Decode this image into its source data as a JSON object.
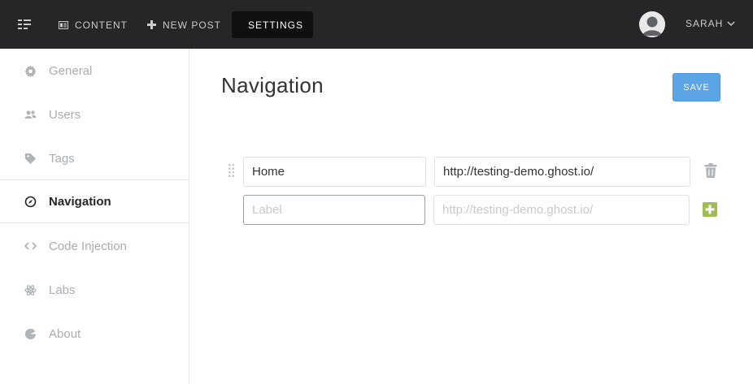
{
  "topbar": {
    "menu_icon": "sidebar-toggle-icon",
    "items": [
      {
        "label": "Content",
        "icon": "content-icon"
      },
      {
        "label": "New Post",
        "icon": "plus-icon"
      },
      {
        "label": "Settings",
        "icon": "gears-icon"
      }
    ],
    "user": {
      "name": "SARAH",
      "avatar_icon": "user-avatar"
    }
  },
  "sidebar": {
    "items": [
      {
        "label": "General",
        "icon": "gear-icon"
      },
      {
        "label": "Users",
        "icon": "users-icon"
      },
      {
        "label": "Tags",
        "icon": "tag-icon"
      },
      {
        "label": "Navigation",
        "icon": "compass-icon",
        "active": true
      },
      {
        "label": "Code Injection",
        "icon": "code-icon"
      },
      {
        "label": "Labs",
        "icon": "atom-icon"
      },
      {
        "label": "About",
        "icon": "ghost-icon"
      }
    ]
  },
  "main": {
    "title": "Navigation",
    "save_label": "SAVE",
    "nav_items": [
      {
        "label": "Home",
        "url": "http://testing-demo.ghost.io/"
      }
    ],
    "new_item": {
      "label_placeholder": "Label",
      "url_placeholder": "http://testing-demo.ghost.io/"
    }
  },
  "colors": {
    "topbar_bg": "#242628",
    "active_nav_bg": "#0f1010",
    "save_button": "#5ba4e5",
    "add_button": "#9fbb58",
    "sidebar_text": "#a8adb1"
  }
}
